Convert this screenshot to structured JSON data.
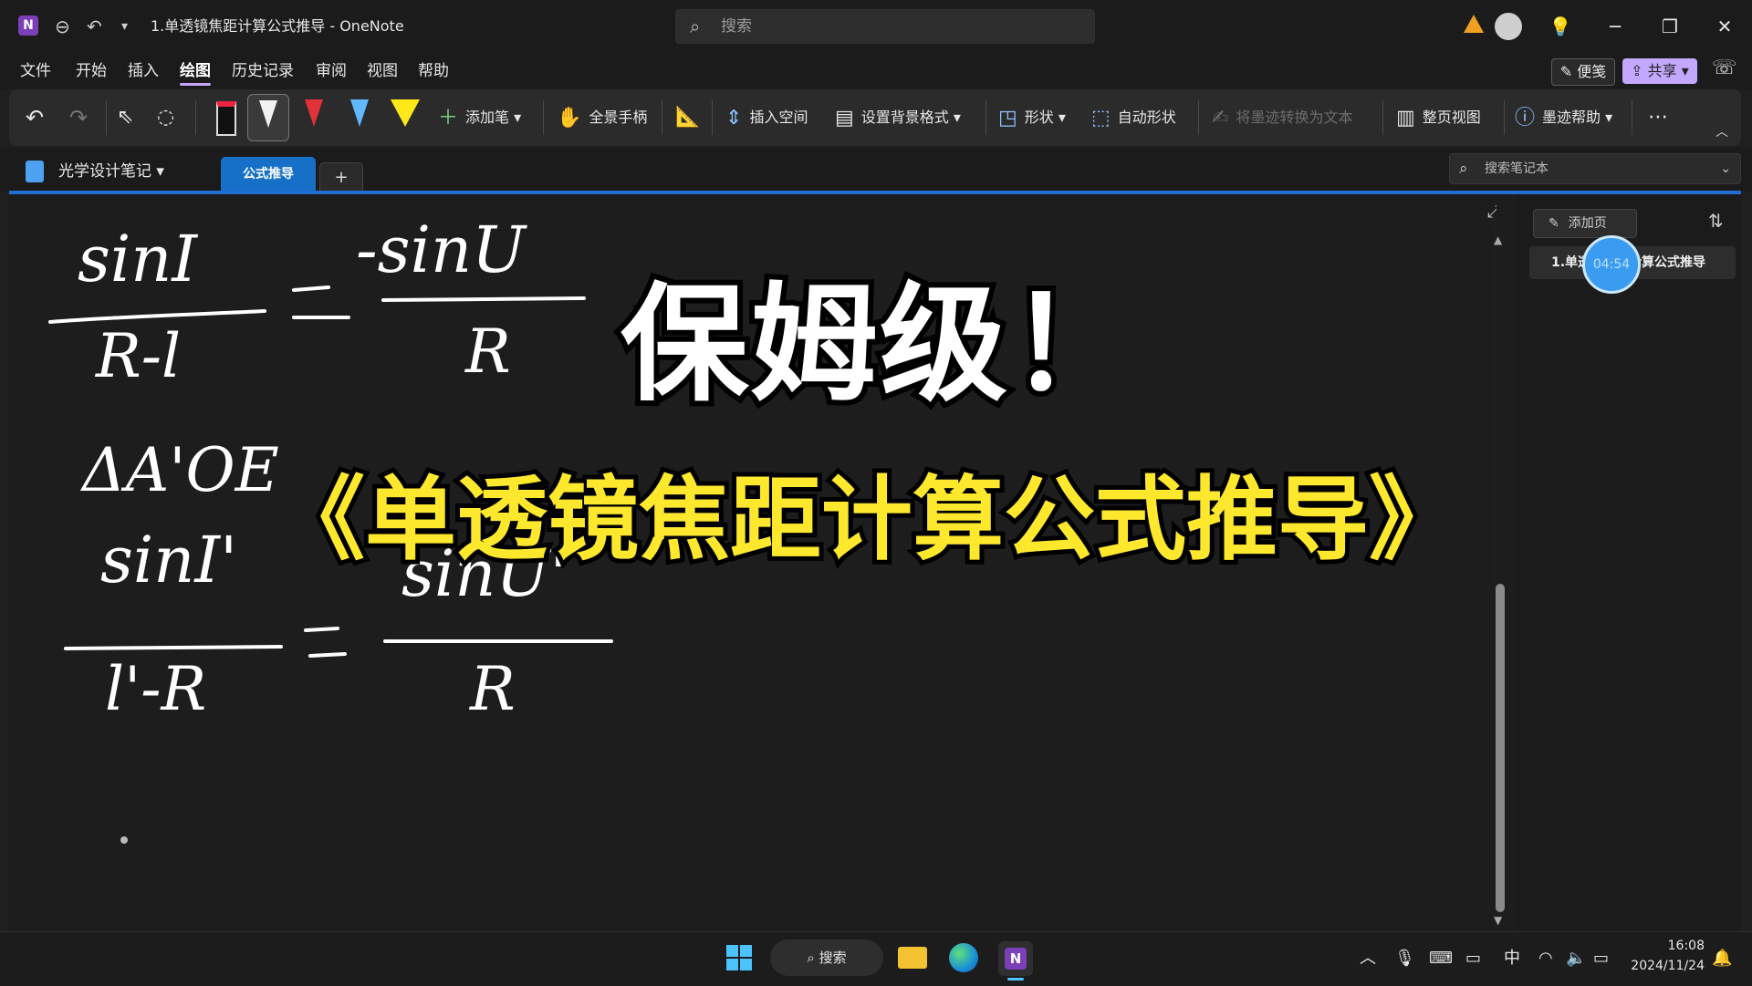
{
  "titlebar": {
    "doc_title": "1.单透镜焦距计算公式推导 - OneNote",
    "search_placeholder": "搜索"
  },
  "menu": [
    "文件",
    "开始",
    "插入",
    "绘图",
    "历史记录",
    "审阅",
    "视图",
    "帮助"
  ],
  "menu_active": "绘图",
  "top_right": {
    "note_label": "便笺",
    "share_label": "共享"
  },
  "ribbon": {
    "add_pen": "添加笔",
    "pan": "全景手柄",
    "insert_space": "插入空间",
    "background": "设置背景格式",
    "shapes": "形状",
    "auto_shapes": "自动形状",
    "ink_to_text": "将墨迹转换为文本",
    "page_view": "整页视图",
    "ink_help": "墨迹帮助"
  },
  "notebook": {
    "name": "光学设计笔记",
    "section_tab": "公式推导",
    "search_placeholder": "搜索笔记本"
  },
  "pages": {
    "add_page": "添加页",
    "items": [
      "1.单透镜焦距计算公式推导"
    ],
    "timer": "04:54"
  },
  "handwriting": {
    "eq1_num_left": "sinI",
    "eq1_den_left": "R-l",
    "eq1_num_right": "-sinU",
    "eq1_den_right": "R",
    "triangle": "ΔA'OE",
    "eq2_num_left": "sinI'",
    "eq2_den_left": "l'-R",
    "eq2_num_right": "sinU'",
    "eq2_den_right": "R"
  },
  "overlay": {
    "title": "保姆级！",
    "subtitle": "《单透镜焦距计算公式推导》"
  },
  "taskbar": {
    "search": "搜索",
    "ime": "中",
    "time": "16:08",
    "date": "2024/11/24"
  },
  "colors": {
    "accent": "#1f6ed1",
    "share": "#c4a8ff",
    "overlay_yellow": "#fde82e",
    "bubble": "#3a9cf0"
  }
}
